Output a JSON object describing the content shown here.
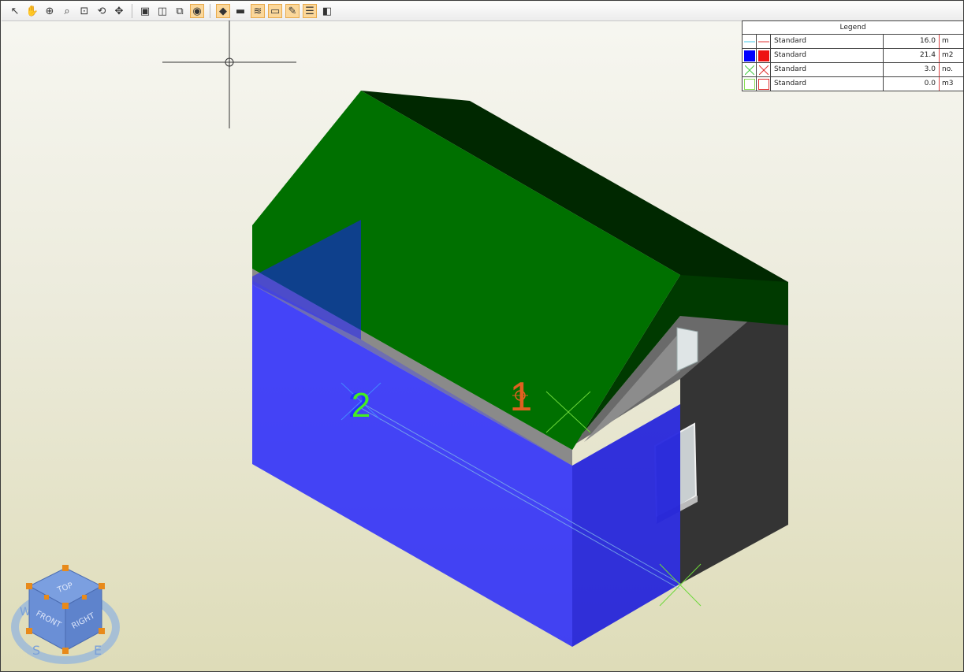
{
  "toolbar": {
    "tools": [
      {
        "name": "select-tool-icon",
        "glyph": "↖",
        "active": false
      },
      {
        "name": "pan-tool-icon",
        "glyph": "✋",
        "active": false
      },
      {
        "name": "zoom-in-icon",
        "glyph": "⊕",
        "active": false
      },
      {
        "name": "zoom-window-icon",
        "glyph": "⌕",
        "active": false
      },
      {
        "name": "zoom-extents-icon",
        "glyph": "⊡",
        "active": false
      },
      {
        "name": "zoom-previous-icon",
        "glyph": "⟲",
        "active": false
      },
      {
        "name": "orbit-icon",
        "glyph": "✥",
        "active": false
      },
      {
        "name": "view-top-icon",
        "glyph": "▣",
        "active": false
      },
      {
        "name": "view-box-icon",
        "glyph": "◫",
        "active": false
      },
      {
        "name": "view-perspective-icon",
        "glyph": "⧉",
        "active": false
      },
      {
        "name": "render-mode-icon",
        "glyph": "◉",
        "active": true
      },
      {
        "name": "layer-fill-icon",
        "glyph": "◆",
        "active": true
      },
      {
        "name": "section-icon",
        "glyph": "▬",
        "active": false
      },
      {
        "name": "layers-icon",
        "glyph": "≋",
        "active": true
      },
      {
        "name": "measure-ruler-icon",
        "glyph": "▭",
        "active": true
      },
      {
        "name": "pencil-icon",
        "glyph": "✎",
        "active": true
      },
      {
        "name": "properties-panel-icon",
        "glyph": "☰",
        "active": true
      },
      {
        "name": "window-layout-icon",
        "glyph": "◧",
        "active": false
      }
    ]
  },
  "legend": {
    "title": "Legend",
    "rows": [
      {
        "symbol": "line",
        "name": "Standard",
        "value": "16.0",
        "unit": "m",
        "color1": "#44c8e8",
        "color2": "#e03030"
      },
      {
        "symbol": "area",
        "name": "Standard",
        "value": "21.4",
        "unit": "m2",
        "color1": "#0000ff",
        "color2": "#ee1111"
      },
      {
        "symbol": "count",
        "name": "Standard",
        "value": "3.0",
        "unit": "no.",
        "color1": "#44cc44",
        "color2": "#e03030"
      },
      {
        "symbol": "volume",
        "name": "Standard",
        "value": "0.0",
        "unit": "m3",
        "color1": "#88dd55",
        "color2": "#e03030"
      }
    ]
  },
  "markers": {
    "marker_1": "1",
    "marker_2": "2"
  },
  "viewcube": {
    "top": "TOP",
    "front": "FRONT",
    "right": "RIGHT",
    "compass_w": "W",
    "compass_s": "S",
    "compass_e": "E"
  },
  "colors": {
    "roof_front": "#007000",
    "roof_back": "#002800",
    "area_overlay": "#1a1aff",
    "wall_dark": "#353535",
    "marker_1": "#e06020",
    "marker_2": "#44ee22"
  }
}
